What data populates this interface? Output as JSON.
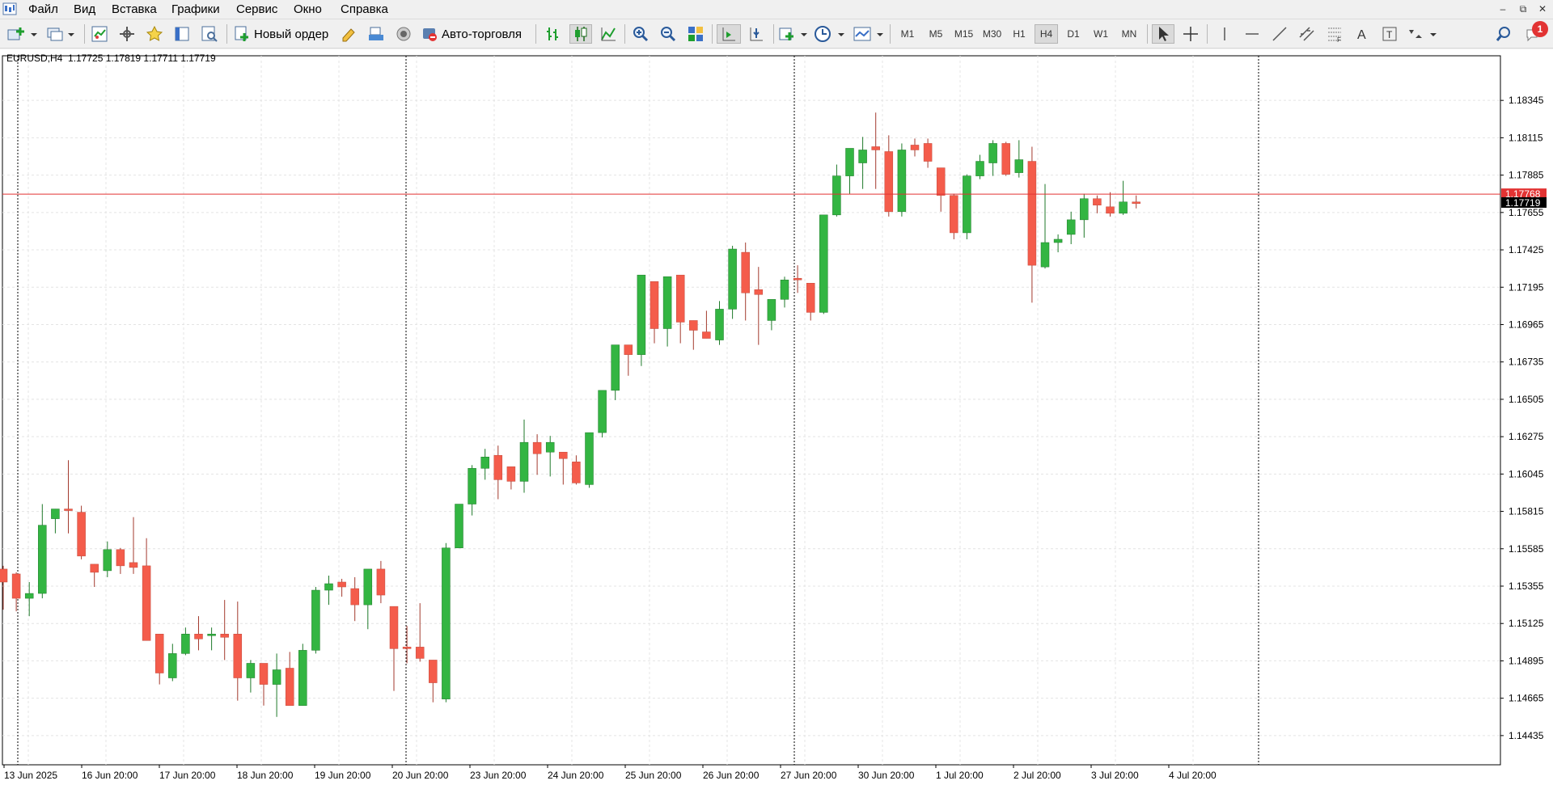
{
  "menu": {
    "items": [
      "Файл",
      "Вид",
      "Вставка",
      "Графики",
      "Сервис",
      "Окно",
      "Справка"
    ]
  },
  "window_controls": {
    "minimize": "–",
    "restore": "⧉",
    "close": "✕"
  },
  "toolbar": {
    "new_order_label": "Новый ордер",
    "auto_trading_label": "Авто-торговля",
    "timeframes": [
      "M1",
      "M5",
      "M15",
      "M30",
      "H1",
      "H4",
      "D1",
      "W1",
      "MN"
    ],
    "active_timeframe": "H4",
    "notification_count": "1",
    "icons": [
      "new-chart-icon",
      "profiles-icon",
      "market-watch-icon",
      "data-window-icon",
      "navigator-icon",
      "terminal-icon",
      "strategy-tester-icon",
      "new-order-icon",
      "metaeditor-icon",
      "market-icon",
      "signals-icon",
      "auto-trading-icon",
      "bar-chart-icon",
      "candlestick-icon",
      "line-chart-icon",
      "zoom-in-icon",
      "zoom-out-icon",
      "tile-windows-icon",
      "chart-shift-icon",
      "autoscroll-icon",
      "indicators-icon",
      "periods-icon",
      "templates-icon",
      "cursor-icon",
      "crosshair-icon",
      "vertical-line-icon",
      "horizontal-line-icon",
      "trend-line-icon",
      "equidistant-channel-icon",
      "fibonacci-icon",
      "text-icon",
      "text-label-icon",
      "arrows-icon",
      "search-icon",
      "notifications-icon"
    ]
  },
  "chart": {
    "info": "EURUSD,H4  1.17725 1.17819 1.17711 1.17719",
    "symbol": "EURUSD",
    "period": "H4",
    "ohlc": {
      "open": 1.17725,
      "high": 1.17819,
      "low": 1.17711,
      "close": 1.17719
    },
    "ask_label": "1.17768",
    "bid_label": "1.17719",
    "colors": {
      "bull": "#33b542",
      "bear": "#f45c4b",
      "ask_line": "#e23333",
      "bid_bg": "#000000",
      "ask_bg": "#e23333",
      "grid": "#e4e4e4",
      "sep": "#000000"
    }
  },
  "chart_data": {
    "type": "candlestick",
    "ylim": [
      1.143,
      1.1853
    ],
    "price_ticks": [
      "1.18345",
      "1.18115",
      "1.17885",
      "1.17655",
      "1.17425",
      "1.17195",
      "1.16965",
      "1.16735",
      "1.16505",
      "1.16275",
      "1.16045",
      "1.15815",
      "1.15585",
      "1.15355",
      "1.15125",
      "1.14895",
      "1.14665",
      "1.14435"
    ],
    "time_labels": [
      "13 Jun 2025",
      "16 Jun 20:00",
      "17 Jun 20:00",
      "18 Jun 20:00",
      "19 Jun 20:00",
      "20 Jun 20:00",
      "23 Jun 20:00",
      "24 Jun 20:00",
      "25 Jun 20:00",
      "26 Jun 20:00",
      "27 Jun 20:00",
      "30 Jun 20:00",
      "1 Jul 20:00",
      "2 Jul 20:00",
      "3 Jul 20:00",
      "4 Jul 20:00"
    ],
    "candles": [
      [
        1.1546,
        1.1548,
        1.1521,
        1.1538
      ],
      [
        1.1543,
        1.1544,
        1.152,
        1.1528
      ],
      [
        1.1528,
        1.1538,
        1.1517,
        1.1531
      ],
      [
        1.1531,
        1.1586,
        1.1528,
        1.1573
      ],
      [
        1.1577,
        1.1583,
        1.1568,
        1.1583
      ],
      [
        1.1583,
        1.1613,
        1.1568,
        1.1582
      ],
      [
        1.1581,
        1.1585,
        1.1552,
        1.1554
      ],
      [
        1.1549,
        1.1549,
        1.1535,
        1.1544
      ],
      [
        1.1545,
        1.1563,
        1.1541,
        1.1558
      ],
      [
        1.1558,
        1.1559,
        1.1543,
        1.1548
      ],
      [
        1.155,
        1.1578,
        1.1543,
        1.1547
      ],
      [
        1.1548,
        1.1565,
        1.1502,
        1.1502
      ],
      [
        1.1506,
        1.1506,
        1.1475,
        1.1482
      ],
      [
        1.1479,
        1.15,
        1.1477,
        1.1494
      ],
      [
        1.1494,
        1.151,
        1.1493,
        1.1506
      ],
      [
        1.1506,
        1.1517,
        1.1496,
        1.1503
      ],
      [
        1.1506,
        1.151,
        1.1496,
        1.1506
      ],
      [
        1.1506,
        1.1527,
        1.149,
        1.1504
      ],
      [
        1.1506,
        1.1526,
        1.1465,
        1.1479
      ],
      [
        1.1479,
        1.149,
        1.147,
        1.1488
      ],
      [
        1.1488,
        1.1488,
        1.1462,
        1.1475
      ],
      [
        1.1475,
        1.1494,
        1.1455,
        1.1484
      ],
      [
        1.1485,
        1.1495,
        1.1466,
        1.1462
      ],
      [
        1.1462,
        1.15,
        1.1462,
        1.1496
      ],
      [
        1.1496,
        1.1535,
        1.1494,
        1.1533
      ],
      [
        1.1533,
        1.1542,
        1.1524,
        1.1537
      ],
      [
        1.1538,
        1.154,
        1.1529,
        1.1535
      ],
      [
        1.1534,
        1.1541,
        1.1514,
        1.1524
      ],
      [
        1.1524,
        1.1545,
        1.1509,
        1.1546
      ],
      [
        1.1546,
        1.1551,
        1.1525,
        1.153
      ],
      [
        1.1523,
        1.1523,
        1.1471,
        1.1497
      ],
      [
        1.1498,
        1.1511,
        1.1488,
        1.1497
      ],
      [
        1.1498,
        1.1525,
        1.1489,
        1.1491
      ],
      [
        1.149,
        1.149,
        1.1464,
        1.1476
      ],
      [
        1.1466,
        1.1562,
        1.1464,
        1.1559
      ],
      [
        1.1559,
        1.1583,
        1.1559,
        1.1586
      ],
      [
        1.1586,
        1.161,
        1.1579,
        1.1608
      ],
      [
        1.1608,
        1.162,
        1.1601,
        1.1615
      ],
      [
        1.1616,
        1.1622,
        1.1589,
        1.1601
      ],
      [
        1.1609,
        1.1609,
        1.1595,
        1.16
      ],
      [
        1.16,
        1.1638,
        1.1593,
        1.1624
      ],
      [
        1.1624,
        1.1629,
        1.1604,
        1.1617
      ],
      [
        1.1618,
        1.1628,
        1.1603,
        1.1624
      ],
      [
        1.1618,
        1.1618,
        1.1598,
        1.1614
      ],
      [
        1.1612,
        1.1616,
        1.1598,
        1.1599
      ],
      [
        1.1598,
        1.163,
        1.1596,
        1.163
      ],
      [
        1.163,
        1.1651,
        1.1627,
        1.1656
      ],
      [
        1.1656,
        1.1678,
        1.165,
        1.1684
      ],
      [
        1.1684,
        1.1681,
        1.1665,
        1.1678
      ],
      [
        1.1678,
        1.1724,
        1.1671,
        1.1727
      ],
      [
        1.1723,
        1.1723,
        1.1685,
        1.1694
      ],
      [
        1.1694,
        1.1725,
        1.1683,
        1.1726
      ],
      [
        1.1727,
        1.1719,
        1.1685,
        1.1698
      ],
      [
        1.1699,
        1.1699,
        1.1681,
        1.1693
      ],
      [
        1.1692,
        1.1705,
        1.1688,
        1.1688
      ],
      [
        1.1687,
        1.1711,
        1.1684,
        1.1706
      ],
      [
        1.1706,
        1.1745,
        1.17,
        1.1743
      ],
      [
        1.1741,
        1.1747,
        1.1699,
        1.1716
      ],
      [
        1.1718,
        1.1732,
        1.1684,
        1.1715
      ],
      [
        1.1699,
        1.1707,
        1.1693,
        1.1712
      ],
      [
        1.1712,
        1.1726,
        1.1707,
        1.1724
      ],
      [
        1.1725,
        1.1733,
        1.1716,
        1.1724
      ],
      [
        1.1722,
        1.1722,
        1.1699,
        1.1704
      ],
      [
        1.1704,
        1.1763,
        1.1703,
        1.1764
      ],
      [
        1.1764,
        1.1795,
        1.1763,
        1.1788
      ],
      [
        1.1788,
        1.1801,
        1.1777,
        1.1805
      ],
      [
        1.1796,
        1.1812,
        1.178,
        1.1804
      ],
      [
        1.1806,
        1.1827,
        1.178,
        1.1804
      ],
      [
        1.1803,
        1.1813,
        1.1763,
        1.1766
      ],
      [
        1.1766,
        1.1808,
        1.1763,
        1.1804
      ],
      [
        1.1807,
        1.1811,
        1.18,
        1.1804
      ],
      [
        1.1808,
        1.1811,
        1.1793,
        1.1797
      ],
      [
        1.1793,
        1.1793,
        1.1766,
        1.1776
      ],
      [
        1.1776,
        1.1777,
        1.1749,
        1.1753
      ],
      [
        1.1753,
        1.1789,
        1.1749,
        1.1788
      ],
      [
        1.1788,
        1.1801,
        1.1786,
        1.1797
      ],
      [
        1.1796,
        1.181,
        1.1788,
        1.1808
      ],
      [
        1.1808,
        1.1809,
        1.1788,
        1.1789
      ],
      [
        1.179,
        1.181,
        1.1787,
        1.1798
      ],
      [
        1.1797,
        1.1806,
        1.171,
        1.1733
      ],
      [
        1.1732,
        1.1783,
        1.1731,
        1.1747
      ],
      [
        1.1747,
        1.1752,
        1.1741,
        1.1749
      ],
      [
        1.1752,
        1.1766,
        1.1746,
        1.1761
      ],
      [
        1.1761,
        1.1777,
        1.175,
        1.1774
      ],
      [
        1.1774,
        1.1776,
        1.1765,
        1.177
      ],
      [
        1.1769,
        1.1778,
        1.1763,
        1.1765
      ],
      [
        1.1765,
        1.1785,
        1.1764,
        1.1772
      ],
      [
        1.1772,
        1.1776,
        1.1768,
        1.1771
      ]
    ]
  }
}
